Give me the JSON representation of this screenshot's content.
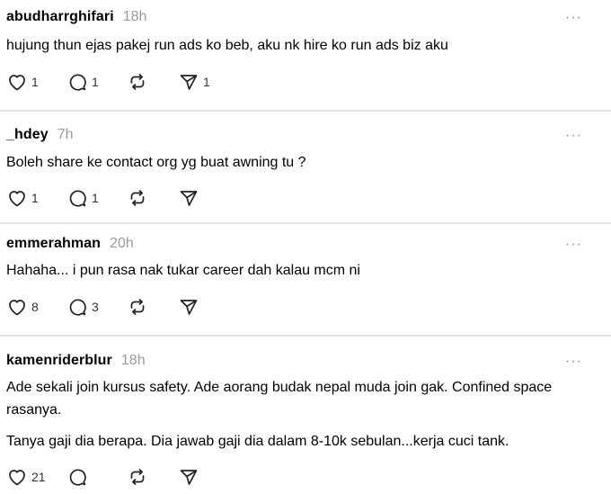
{
  "posts": [
    {
      "username": "abudharrghifari",
      "time": "18h",
      "more": "···",
      "paragraphs": [
        "hujung thun ejas pakej run ads ko beb, aku nk hire ko run ads biz aku"
      ],
      "likes": "1",
      "replies": "1",
      "shares": "1"
    },
    {
      "username": "_hdey",
      "time": "7h",
      "more": "···",
      "paragraphs": [
        "Boleh share ke contact org yg buat awning tu ?"
      ],
      "likes": "1",
      "replies": "1",
      "shares": ""
    },
    {
      "username": "emmerahman",
      "time": "20h",
      "more": "···",
      "paragraphs": [
        "Hahaha... i pun rasa nak tukar career dah kalau mcm ni"
      ],
      "likes": "8",
      "replies": "3",
      "shares": ""
    },
    {
      "username": "kamenriderblur",
      "time": "18h",
      "more": "···",
      "paragraphs": [
        "Ade sekali join kursus safety. Ade aorang budak nepal muda join gak. Confined space rasanya.",
        "Tanya gaji dia berapa. Dia jawab gaji dia dalam 8-10k sebulan...kerja cuci tank."
      ],
      "likes": "21",
      "replies": "",
      "shares": ""
    }
  ]
}
